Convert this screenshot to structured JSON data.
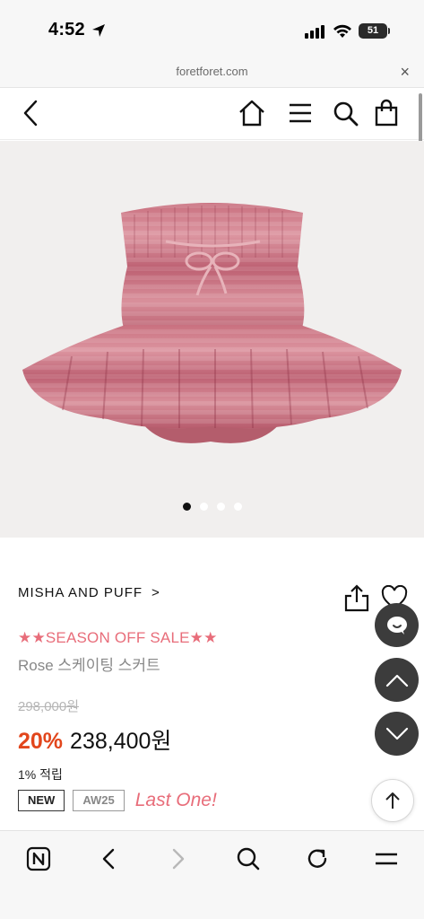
{
  "status_bar": {
    "time": "4:52",
    "battery": "51"
  },
  "browser": {
    "url": "foretforet.com",
    "close_label": "×"
  },
  "header": {
    "back_icon": "chevron-left-icon",
    "home_icon": "home-icon",
    "menu_icon": "hamburger-menu-icon",
    "search_icon": "search-icon",
    "cart_icon": "shopping-bag-icon"
  },
  "gallery": {
    "slide_count": 4,
    "active_slide": 1
  },
  "product": {
    "brand": "MISHA AND PUFF",
    "brand_chevron": ">",
    "sale_title": "★★SEASON OFF SALE★★",
    "name": "Rose 스케이팅 스커트",
    "original_price": "298,000원",
    "discount": "20%",
    "sale_price": "238,400원",
    "points": "1% 적립",
    "tags": [
      "NEW",
      "AW25"
    ],
    "last_one": "Last One!"
  },
  "colors": {
    "sale_pink": "#e86d7a",
    "discount_orange": "#e2461c",
    "fab_dark": "#3c3c3c",
    "product_rose": "#c9707f"
  },
  "bottom_toolbar": {
    "icons": [
      "naver-n-icon",
      "back-arrow-icon",
      "forward-arrow-icon",
      "search-icon",
      "refresh-icon",
      "menu-icon"
    ]
  }
}
